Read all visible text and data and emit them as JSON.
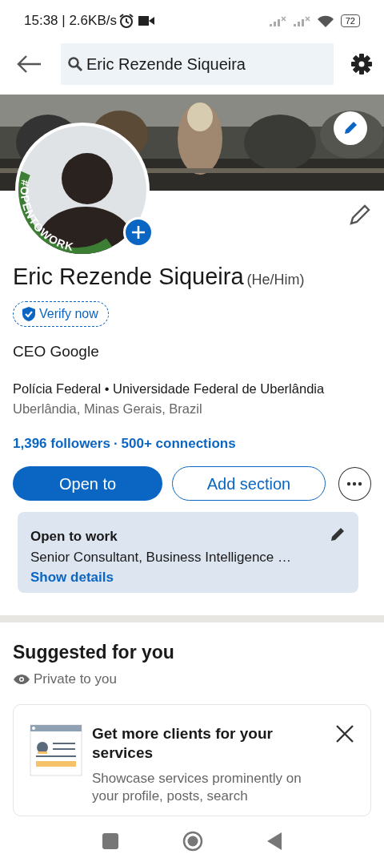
{
  "status_bar": {
    "time": "15:38 | 2.6KB/s",
    "battery": "72"
  },
  "search": {
    "value": "Eric Rezende Siqueira"
  },
  "profile": {
    "frame_label": "#OPENTOWORK",
    "name": "Eric Rezende Siqueira",
    "pronouns": "(He/Him)",
    "verify": "Verify now",
    "headline": "CEO Google",
    "organizations": "Polícia Federal • Universidade Federal de Uberlândia",
    "location": "Uberlândia, Minas Gerais, Brazil",
    "followers": "1,396 followers",
    "separator": "·",
    "connections": "500+ connections"
  },
  "actions": [
    {
      "label": "Open to",
      "kind": "primary"
    },
    {
      "label": "Add section",
      "kind": "outline"
    }
  ],
  "open_to_work": {
    "title": "Open to work",
    "roles": "Senior Consultant, Business Intelligence …",
    "link": "Show details"
  },
  "suggested": {
    "title": "Suggested for you",
    "privacy": "Private to you",
    "card": {
      "title": "Get more clients for your services",
      "body": "Showcase services prominently on your profile, posts, search"
    }
  }
}
